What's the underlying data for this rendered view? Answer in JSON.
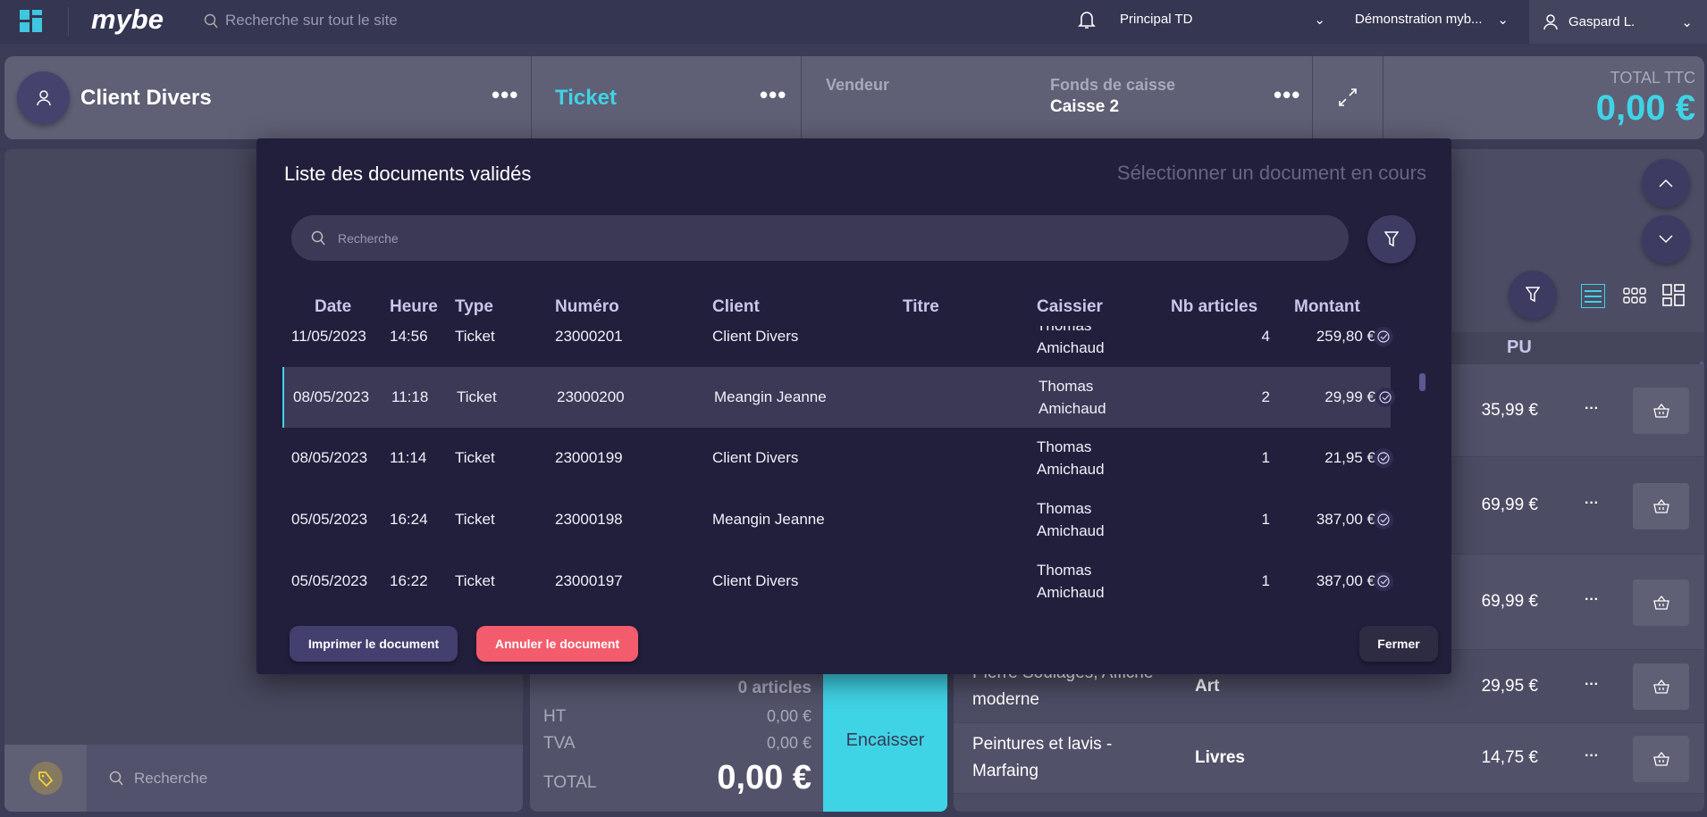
{
  "topbar": {
    "brand": "mybe",
    "search_placeholder": "Recherche sur tout le site",
    "store": "Principal TD",
    "company": "Démonstration myb...",
    "user": "Gaspard L."
  },
  "header": {
    "client": "Client Divers",
    "doc_type": "Ticket",
    "vendeur_label": "Vendeur",
    "fonds_label": "Fonds de caisse",
    "fonds_value": "Caisse 2",
    "total_label": "TOTAL TTC",
    "total_value": "0,00 €"
  },
  "modal": {
    "title": "Liste des documents validés",
    "select_current": "Sélectionner un document en cours",
    "search_placeholder": "Recherche",
    "columns": [
      "Date",
      "Heure",
      "Type",
      "Numéro",
      "Client",
      "Titre",
      "Caissier",
      "Nb articles",
      "Montant"
    ],
    "rows": [
      {
        "date": "11/05/2023",
        "heure": "14:56",
        "type": "Ticket",
        "numero": "23000201",
        "client": "Client Divers",
        "titre": "",
        "caissier1": "Thomas",
        "caissier2": "Amichaud",
        "nb": "4",
        "montant": "259,80 €"
      },
      {
        "date": "08/05/2023",
        "heure": "11:18",
        "type": "Ticket",
        "numero": "23000200",
        "client": "Meangin Jeanne",
        "titre": "",
        "caissier1": "Thomas",
        "caissier2": "Amichaud",
        "nb": "2",
        "montant": "29,99 €"
      },
      {
        "date": "08/05/2023",
        "heure": "11:14",
        "type": "Ticket",
        "numero": "23000199",
        "client": "Client Divers",
        "titre": "",
        "caissier1": "Thomas",
        "caissier2": "Amichaud",
        "nb": "1",
        "montant": "21,95 €"
      },
      {
        "date": "05/05/2023",
        "heure": "16:24",
        "type": "Ticket",
        "numero": "23000198",
        "client": "Meangin Jeanne",
        "titre": "",
        "caissier1": "Thomas",
        "caissier2": "Amichaud",
        "nb": "1",
        "montant": "387,00 €"
      },
      {
        "date": "05/05/2023",
        "heure": "16:22",
        "type": "Ticket",
        "numero": "23000197",
        "client": "Client Divers",
        "titre": "",
        "caissier1": "Thomas",
        "caissier2": "Amichaud",
        "nb": "1",
        "montant": "387,00 €"
      }
    ],
    "print_label": "Imprimer le document",
    "cancel_label": "Annuler le document",
    "close_label": "Fermer"
  },
  "totals": {
    "articles": "0 articles",
    "ht_label": "HT",
    "ht": "0,00 €",
    "tva_label": "TVA",
    "tva": "0,00 €",
    "total_label": "TOTAL",
    "total": "0,00 €",
    "pay_label": "Encaisser"
  },
  "left": {
    "search_placeholder": "Recherche"
  },
  "products": {
    "pu_header": "PU",
    "items": [
      {
        "name": "",
        "category": "",
        "pu": "35,99 €"
      },
      {
        "name": "",
        "category": "",
        "pu": "69,99 €"
      },
      {
        "name": "",
        "category": "",
        "pu": "69,99 €"
      },
      {
        "name": "Pierre Soulages, Affiche moderne",
        "category": "Art",
        "pu": "29,95 €"
      },
      {
        "name": "Peintures et lavis - Marfaing",
        "category": "Livres",
        "pu": "14,75 €"
      }
    ]
  },
  "colors": {
    "accent": "#3fd3e6",
    "danger": "#f25c6c",
    "modal": "#221f3d"
  }
}
